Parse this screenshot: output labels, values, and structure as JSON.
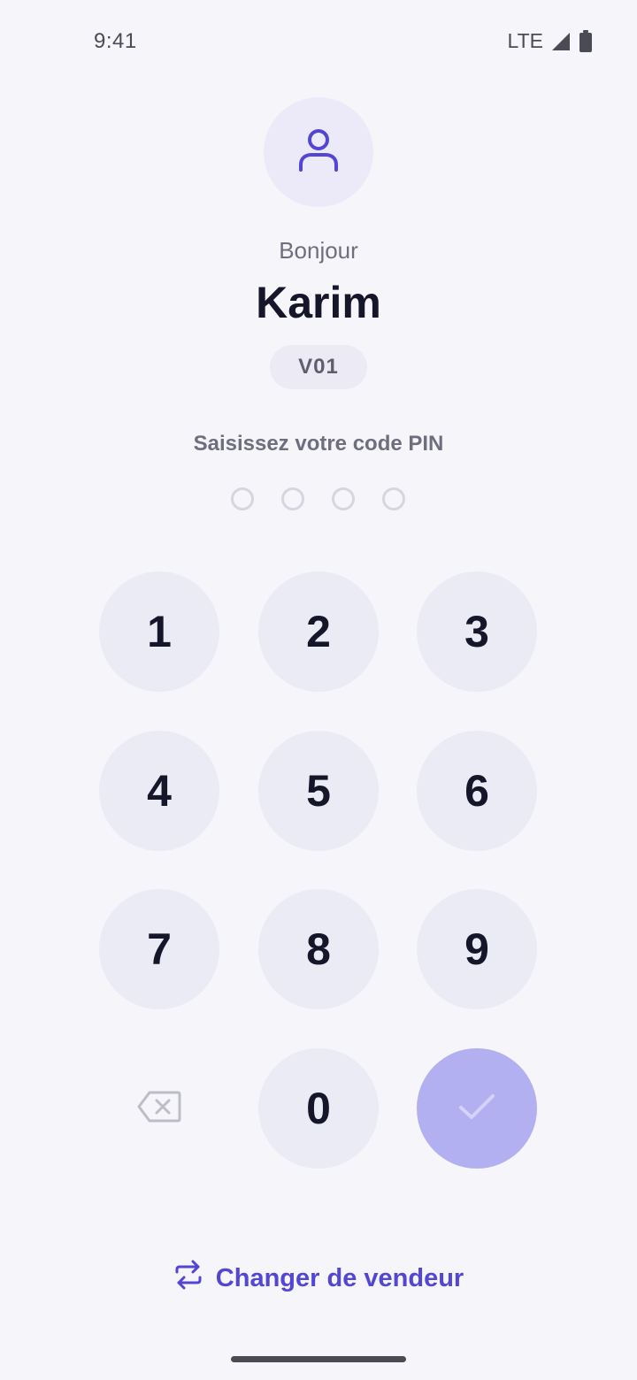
{
  "status_bar": {
    "time": "9:41",
    "network": "LTE",
    "icons": [
      "signal-icon",
      "battery-icon"
    ]
  },
  "profile": {
    "avatar_icon": "user-icon",
    "greeting": "Bonjour",
    "name": "Karim",
    "vendor_code": "V01"
  },
  "pin": {
    "prompt": "Saisissez votre code PIN",
    "length": 4,
    "entered": 0
  },
  "keypad": {
    "keys": [
      "1",
      "2",
      "3",
      "4",
      "5",
      "6",
      "7",
      "8",
      "9",
      "0"
    ],
    "backspace_icon": "backspace-icon",
    "confirm_icon": "check-icon"
  },
  "footer": {
    "switch_vendor_label": "Changer de vendeur",
    "switch_vendor_icon": "swap-icon"
  },
  "colors": {
    "accent": "#5346d4",
    "confirm_disabled": "#b3b0f2",
    "key_background": "#ebebf5",
    "background": "#f5f5fa"
  }
}
